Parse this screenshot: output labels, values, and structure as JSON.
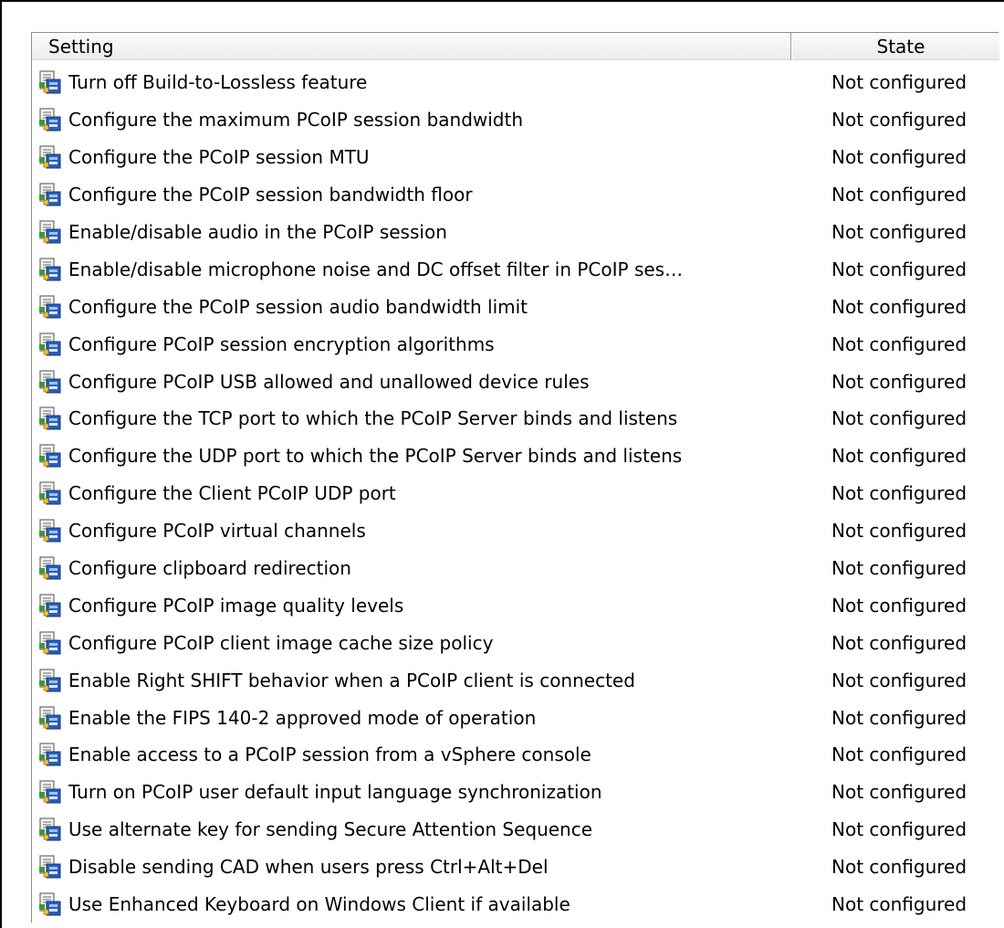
{
  "columns": {
    "setting": "Setting",
    "state": "State"
  },
  "icon": "policy-setting-icon",
  "rows": [
    {
      "name": "Turn off Build-to-Lossless feature",
      "state": "Not configured"
    },
    {
      "name": "Configure the maximum PCoIP session bandwidth",
      "state": "Not configured"
    },
    {
      "name": "Configure the PCoIP session MTU",
      "state": "Not configured"
    },
    {
      "name": "Configure the PCoIP session bandwidth floor",
      "state": "Not configured"
    },
    {
      "name": "Enable/disable audio in the PCoIP session",
      "state": "Not configured"
    },
    {
      "name": "Enable/disable microphone noise and DC offset filter in PCoIP ses…",
      "state": "Not configured"
    },
    {
      "name": "Configure the PCoIP session audio bandwidth limit",
      "state": "Not configured"
    },
    {
      "name": "Configure PCoIP session encryption algorithms",
      "state": "Not configured"
    },
    {
      "name": "Configure PCoIP USB allowed and unallowed device rules",
      "state": "Not configured"
    },
    {
      "name": "Configure the TCP port to which the PCoIP Server binds and listens",
      "state": "Not configured"
    },
    {
      "name": "Configure the UDP port to which the PCoIP Server binds and listens",
      "state": "Not configured"
    },
    {
      "name": "Configure the Client PCoIP UDP port",
      "state": "Not configured"
    },
    {
      "name": "Configure PCoIP virtual channels",
      "state": "Not configured"
    },
    {
      "name": "Configure clipboard redirection",
      "state": "Not configured"
    },
    {
      "name": "Configure PCoIP image quality levels",
      "state": "Not configured"
    },
    {
      "name": "Configure PCoIP client image cache size policy",
      "state": "Not configured"
    },
    {
      "name": "Enable Right SHIFT behavior when a PCoIP client is connected",
      "state": "Not configured"
    },
    {
      "name": "Enable the FIPS 140-2 approved mode of operation",
      "state": "Not configured"
    },
    {
      "name": "Enable access to a PCoIP session from a vSphere console",
      "state": "Not configured"
    },
    {
      "name": "Turn on PCoIP user default input language synchronization",
      "state": "Not configured"
    },
    {
      "name": "Use alternate key for sending Secure Attention Sequence",
      "state": "Not configured"
    },
    {
      "name": "Disable sending CAD when users press Ctrl+Alt+Del",
      "state": "Not configured"
    },
    {
      "name": "Use Enhanced Keyboard on Windows Client if available",
      "state": "Not configured"
    }
  ]
}
